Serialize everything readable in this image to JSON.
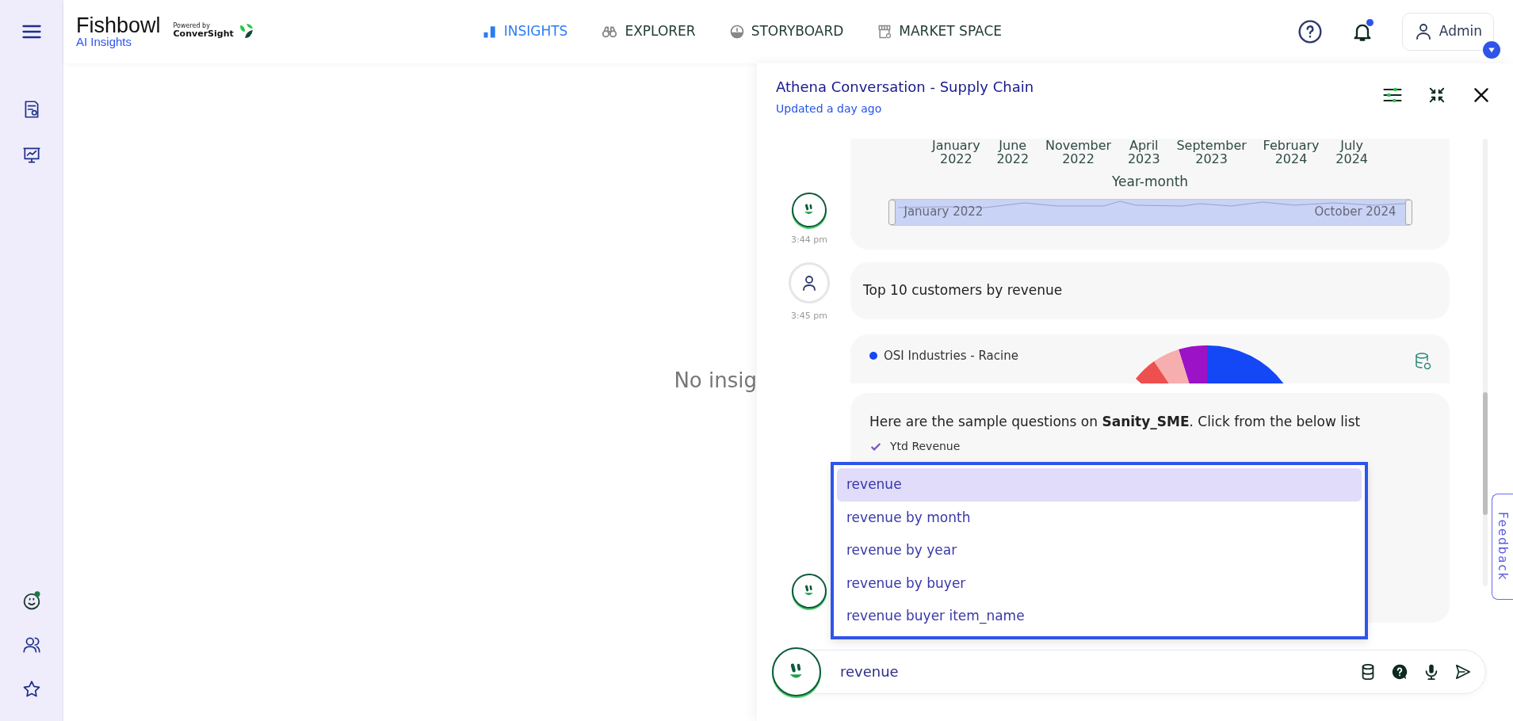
{
  "brand": {
    "name": "Fishbowl",
    "subtitle": "AI Insights",
    "powered_by": "Powered by",
    "partner": "ConverSight"
  },
  "nav": [
    {
      "label": "INSIGHTS",
      "selected": true,
      "kind": "bars"
    },
    {
      "label": "EXPLORER",
      "selected": false,
      "kind": "binoculars"
    },
    {
      "label": "STORYBOARD",
      "selected": false,
      "kind": "gauge"
    },
    {
      "label": "MARKET SPACE",
      "selected": false,
      "kind": "store"
    }
  ],
  "user": {
    "name": "Admin",
    "has_notification": true
  },
  "main": {
    "empty_message": "No insig"
  },
  "panel": {
    "title": "Athena Conversation - Supply Chain",
    "updated": "Updated a day ago"
  },
  "messages": [
    {
      "kind": "chart",
      "from_user": false,
      "time": "3:44 pm",
      "level": 1,
      "axis_labels": [
        [
          "January",
          "2022"
        ],
        [
          "June",
          "2022"
        ],
        [
          "November",
          "2022"
        ],
        [
          "April",
          "2023"
        ],
        [
          "September",
          "2023"
        ],
        [
          "February",
          "2024"
        ],
        [
          "July",
          "2024"
        ]
      ],
      "axis_title": "Year-month",
      "range_start": "January 2022",
      "range_end": "October 2024"
    },
    {
      "kind": "text",
      "from_user": true,
      "time": "3:45 pm",
      "text": "Top 10 customers by revenue"
    },
    {
      "kind": "pie",
      "legend": [
        {
          "label": "OSI Industries - Racine",
          "color": "#1447f5"
        }
      ]
    },
    {
      "kind": "suggestions",
      "from_user": false,
      "text": "Here are the sample questions on **Sanity_SME**. Click from the below list",
      "items": [
        {
          "label": "Ytd Revenue",
          "checked": true
        }
      ]
    }
  ],
  "autocomplete": [
    {
      "label": "revenue",
      "selected": true
    },
    {
      "label": "revenue by month",
      "selected": false
    },
    {
      "label": "revenue by year",
      "selected": false
    },
    {
      "label": "revenue by buyer",
      "selected": false
    },
    {
      "label": "revenue buyer item_name",
      "selected": false
    }
  ],
  "input": {
    "value": "revenue"
  },
  "feedback": "Feedback"
}
